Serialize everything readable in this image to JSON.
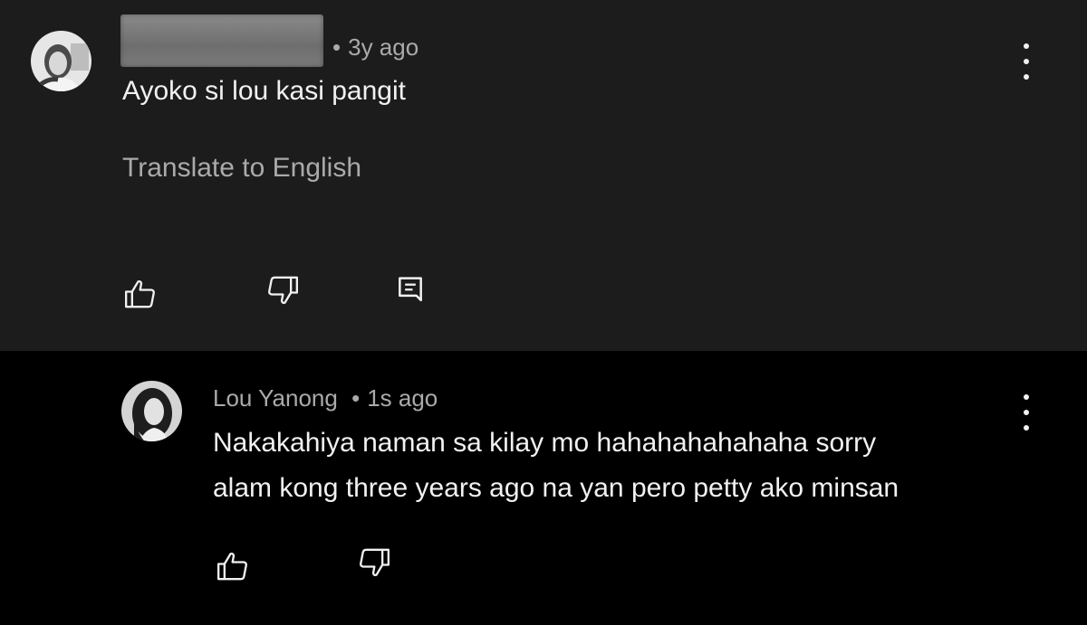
{
  "top_comment": {
    "author_redacted": true,
    "time": "3y ago",
    "separator": "•",
    "text": "Ayoko si lou kasi pangit",
    "translate_label": "Translate to English",
    "actions": {
      "like_icon": "thumbs-up-icon",
      "dislike_icon": "thumbs-down-icon",
      "reply_icon": "reply-comment-icon"
    },
    "menu_icon": "more-vertical-icon"
  },
  "reply_comment": {
    "author": "Lou Yanong",
    "separator": "•",
    "time": "1s ago",
    "text_line1": "Nakakahiya naman sa kilay mo hahahahahahaha sorry",
    "text_line2": "alam kong three years ago na yan pero petty ako minsan",
    "actions": {
      "like_icon": "thumbs-up-icon",
      "dislike_icon": "thumbs-down-icon"
    },
    "menu_icon": "more-vertical-icon"
  },
  "colors": {
    "top_background": "#1c1c1c",
    "reply_background": "#000000",
    "primary_text": "#f1f1f1",
    "secondary_text": "#aaaaaa"
  }
}
